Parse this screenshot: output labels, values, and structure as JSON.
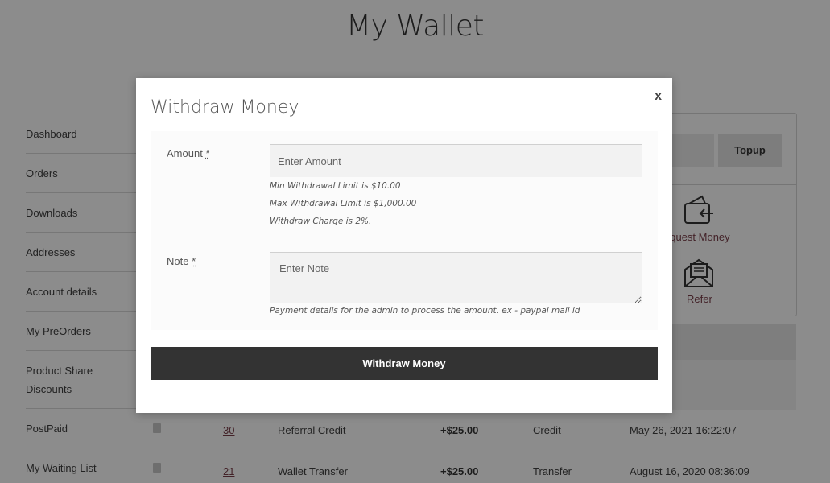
{
  "page": {
    "title": "My Wallet"
  },
  "sidebar": {
    "items": [
      {
        "label": "Dashboard"
      },
      {
        "label": "Orders"
      },
      {
        "label": "Downloads"
      },
      {
        "label": "Addresses"
      },
      {
        "label": "Account details"
      },
      {
        "label": "My PreOrders"
      },
      {
        "label": "Product Share Discounts"
      },
      {
        "label": "PostPaid",
        "icon": "file-icon"
      },
      {
        "label": "My Waiting List",
        "icon": "file-icon"
      }
    ]
  },
  "wallet_panel": {
    "topup_label": "Topup",
    "request_money_label": "equest Money",
    "refer_label": "Refer"
  },
  "transactions": [
    {
      "id": "30",
      "description": "Referral Credit",
      "amount": "+$25.00",
      "type": "Credit",
      "date": "May 26, 2021 16:22:07"
    },
    {
      "id": "21",
      "description": "Wallet Transfer",
      "amount": "+$25.00",
      "type": "Transfer",
      "date": "August 16, 2020 08:36:09"
    }
  ],
  "modal": {
    "title": "Withdraw Money",
    "close_label": "x",
    "amount": {
      "label": "Amount",
      "required_mark": "*",
      "placeholder": "Enter Amount",
      "hints": [
        "Min Withdrawal Limit is $10.00",
        "Max Withdrawal Limit is $1,000.00",
        "Withdraw Charge is 2%."
      ]
    },
    "note": {
      "label": "Note",
      "required_mark": "*",
      "placeholder": "Enter Note",
      "hint": "Payment details for the admin to process the amount. ex - paypal mail id"
    },
    "submit_label": "Withdraw Money"
  },
  "colors": {
    "overlay": "#000000",
    "submit_button": "#333333",
    "link": "#7a3f4a"
  }
}
